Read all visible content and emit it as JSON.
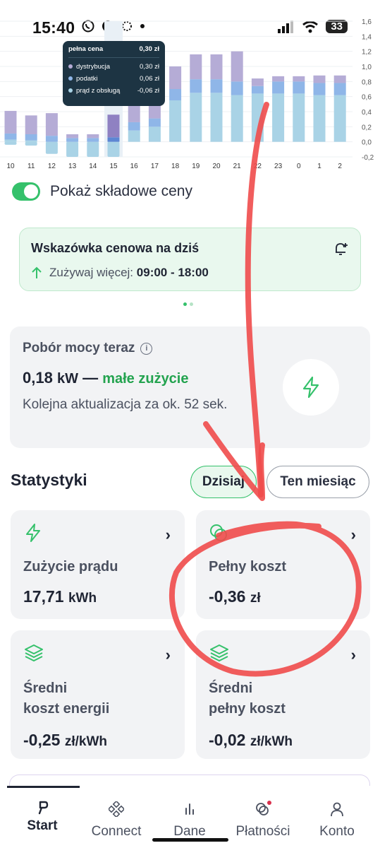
{
  "status_bar": {
    "time": "15:40",
    "battery": "33",
    "icons": [
      "whatsapp-icon",
      "messenger-icon",
      "loading-icon",
      "dot-icon",
      "signal-icon",
      "wifi-icon",
      "battery-icon"
    ]
  },
  "chart_data": {
    "type": "bar",
    "stacked": true,
    "categories": [
      "10",
      "11",
      "12",
      "13",
      "14",
      "15",
      "16",
      "17",
      "18",
      "19",
      "20",
      "21",
      "22",
      "23",
      "0",
      "1",
      "2"
    ],
    "series": [
      {
        "name": "prąd z obsługą",
        "color": "#a9d3e6",
        "values": [
          0.03,
          0.02,
          -0.01,
          -0.05,
          -0.05,
          -0.06,
          0.15,
          0.2,
          0.55,
          0.65,
          0.65,
          0.62,
          0.64,
          0.64,
          0.64,
          0.62,
          0.62
        ]
      },
      {
        "name": "podatki",
        "color": "#8fb6e8",
        "values": [
          0.08,
          0.08,
          0.08,
          0.05,
          0.05,
          0.06,
          0.11,
          0.11,
          0.15,
          0.18,
          0.18,
          0.18,
          0.1,
          0.16,
          0.16,
          0.16,
          0.16
        ]
      },
      {
        "name": "dystrybucja",
        "color": "#b5acd6",
        "values": [
          0.3,
          0.25,
          0.3,
          0.05,
          0.05,
          0.3,
          0.35,
          0.35,
          0.3,
          0.33,
          0.33,
          0.4,
          0.1,
          0.07,
          0.07,
          0.1,
          0.1
        ]
      }
    ],
    "negative_values": [
      -0.04,
      -0.05,
      -0.16,
      -0.2,
      -0.2,
      -0.2,
      0,
      0,
      0,
      0,
      0,
      0,
      0,
      0,
      0,
      0,
      0
    ],
    "highlight_index": 5,
    "ylim": [
      -0.2,
      1.6
    ],
    "y_ticks": [
      "1,6",
      "1,4",
      "1,2",
      "1,0",
      "0,8",
      "0,6",
      "0,4",
      "0,2",
      "0,0",
      "-0,2"
    ],
    "grid": true
  },
  "tooltip": {
    "title": "pełna cena",
    "total": "0,30 zł",
    "rows": [
      {
        "label": "dystrybucja",
        "value": "0,30 zł",
        "color": "#b5acd6"
      },
      {
        "label": "podatki",
        "value": "0,06 zł",
        "color": "#8fb6e8"
      },
      {
        "label": "prąd z obsługą",
        "value": "-0,06 zł",
        "color": "#a9d3e6"
      }
    ]
  },
  "toggle": {
    "label": "Pokaż składowe ceny",
    "on": true
  },
  "hint": {
    "title": "Wskazówka cenowa na dziś",
    "prefix": "Zużywaj więcej:",
    "hours": "09:00 - 18:00"
  },
  "power": {
    "title": "Pobór mocy teraz",
    "value": "0,18",
    "unit": "kW",
    "dash": "—",
    "status": "małe zużycie",
    "update": "Kolejna aktualizacja za ok. 52 sek."
  },
  "stats": {
    "title": "Statystyki",
    "tab_today": "Dzisiaj",
    "tab_month": "Ten miesiąc",
    "cards": [
      {
        "label": "Zużycie prądu",
        "value": "17,71",
        "unit": "kWh"
      },
      {
        "label": "Pełny koszt",
        "value": "-0,36",
        "unit": "zł"
      },
      {
        "label_line1": "Średni",
        "label_line2": "koszt energii",
        "value": "-0,25",
        "unit": "zł/kWh"
      },
      {
        "label_line1": "Średni",
        "label_line2": "pełny koszt",
        "value": "-0,02",
        "unit": "zł/kWh"
      }
    ]
  },
  "nav": {
    "items": [
      {
        "label": "Start",
        "icon": "start-icon",
        "active": true
      },
      {
        "label": "Connect",
        "icon": "connect-icon",
        "active": false
      },
      {
        "label": "Dane",
        "icon": "chart-icon",
        "active": false
      },
      {
        "label": "Płatności",
        "icon": "payments-icon",
        "active": false
      },
      {
        "label": "Konto",
        "icon": "user-icon",
        "active": false
      }
    ]
  },
  "colors": {
    "accent": "#35c16b",
    "annotation": "#ef4b4b",
    "tooltip_bg": "#1d3443"
  }
}
